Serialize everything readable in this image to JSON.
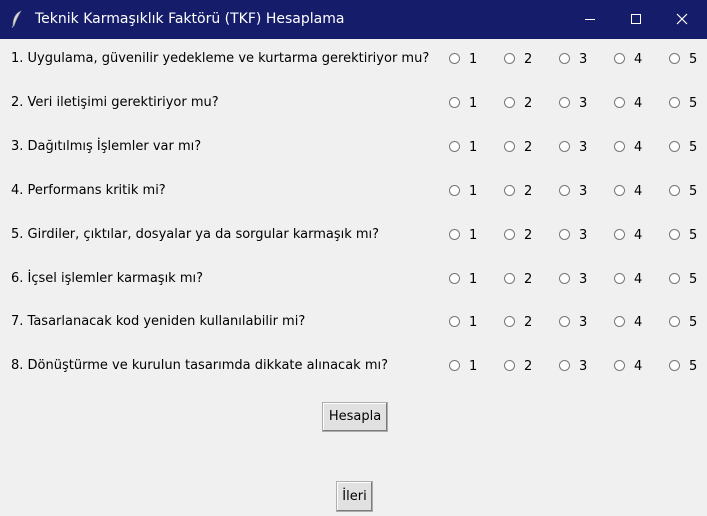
{
  "window": {
    "title": "Teknik Karmaşıklık Faktörü (TKF) Hesaplama"
  },
  "questions": [
    {
      "text": "1. Uygulama, güvenilir yedekleme ve kurtarma gerektiriyor mu?",
      "options": [
        "1",
        "2",
        "3",
        "4",
        "5"
      ],
      "selected": null
    },
    {
      "text": "2. Veri iletişimi gerektiriyor mu?",
      "options": [
        "1",
        "2",
        "3",
        "4",
        "5"
      ],
      "selected": null
    },
    {
      "text": "3. Dağıtılmış İşlemler var mı?",
      "options": [
        "1",
        "2",
        "3",
        "4",
        "5"
      ],
      "selected": null
    },
    {
      "text": "4. Performans kritik mi?",
      "options": [
        "1",
        "2",
        "3",
        "4",
        "5"
      ],
      "selected": null
    },
    {
      "text": "5. Girdiler, çıktılar, dosyalar ya da sorgular karmaşık mı?",
      "options": [
        "1",
        "2",
        "3",
        "4",
        "5"
      ],
      "selected": null
    },
    {
      "text": "6. İçsel işlemler karmaşık mı?",
      "options": [
        "1",
        "2",
        "3",
        "4",
        "5"
      ],
      "selected": null
    },
    {
      "text": "7. Tasarlanacak kod yeniden kullanılabilir mi?",
      "options": [
        "1",
        "2",
        "3",
        "4",
        "5"
      ],
      "selected": null
    },
    {
      "text": "8. Dönüştürme ve kurulun tasarımda dikkate alınacak mı?",
      "options": [
        "1",
        "2",
        "3",
        "4",
        "5"
      ],
      "selected": null
    }
  ],
  "buttons": {
    "calculate_label": "Hesapla",
    "next_label": "İleri"
  },
  "icons": {
    "app": "feather-icon",
    "minimize": "minimize-icon",
    "maximize": "maximize-icon",
    "close": "close-icon"
  }
}
